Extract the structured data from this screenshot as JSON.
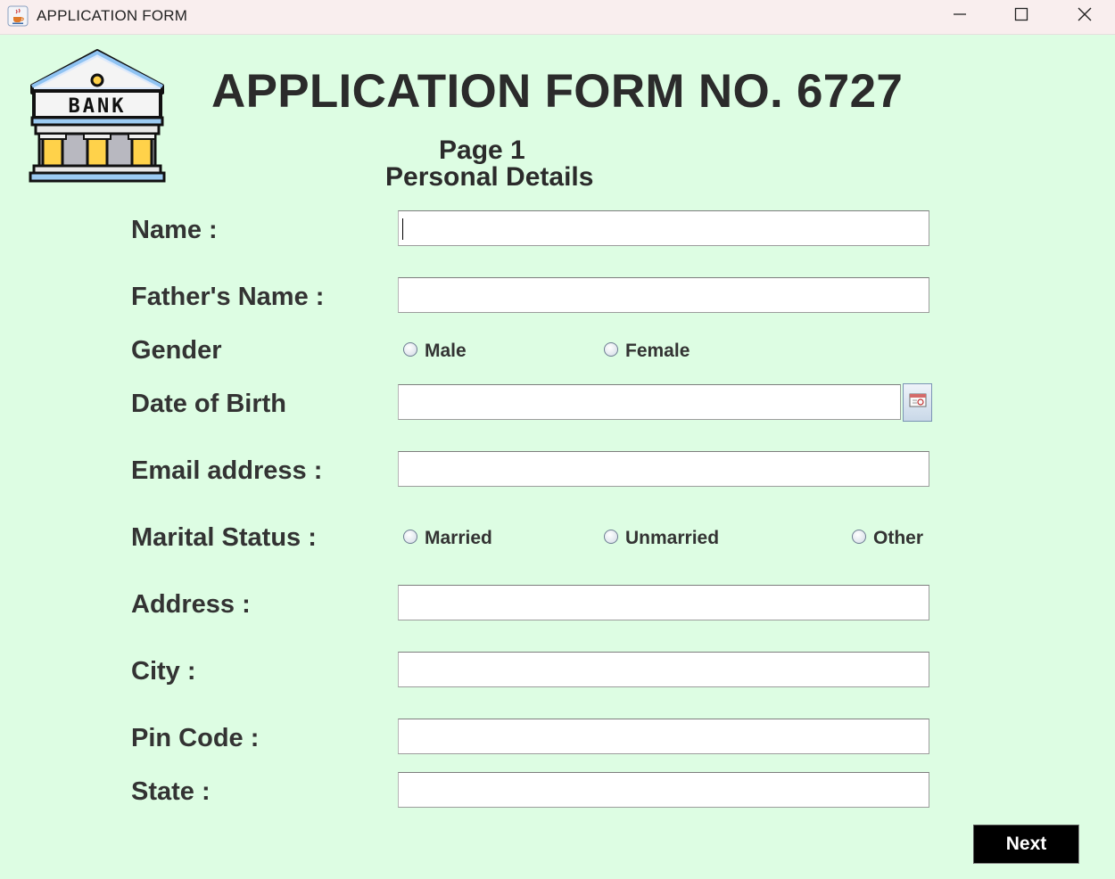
{
  "window": {
    "title": "APPLICATION FORM"
  },
  "logo": {
    "text": "BANK"
  },
  "header": {
    "title": "APPLICATION FORM NO. 6727",
    "page": "Page 1",
    "section": "Personal Details"
  },
  "form": {
    "name_label": "Name :",
    "name_value": "",
    "father_label": "Father's Name :",
    "father_value": "",
    "gender_label": "Gender",
    "gender_options": [
      "Male",
      "Female"
    ],
    "dob_label": "Date of Birth",
    "dob_value": "",
    "email_label": "Email address :",
    "email_value": "",
    "marital_label": "Marital Status :",
    "marital_options": [
      "Married",
      "Unmarried",
      "Other"
    ],
    "address_label": "Address :",
    "address_value": "",
    "city_label": "City :",
    "city_value": "",
    "pin_label": "Pin Code :",
    "pin_value": "",
    "state_label": "State :",
    "state_value": ""
  },
  "actions": {
    "next_label": "Next"
  },
  "icons": {
    "app": "java-cup-icon",
    "calendar": "calendar-icon",
    "minimize": "minimize-icon",
    "maximize": "maximize-icon",
    "close": "close-icon"
  },
  "colors": {
    "background": "#ddfde3",
    "titlebar": "#f9eeee",
    "next_button": "#000000"
  }
}
